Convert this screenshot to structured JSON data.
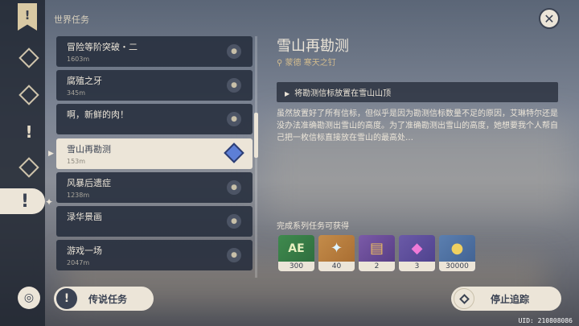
{
  "list_title": "世界任务",
  "quests": [
    {
      "name": "冒险等阶突破・二",
      "dist": "1603m",
      "selected": false
    },
    {
      "name": "腐殖之牙",
      "dist": "345m",
      "selected": false
    },
    {
      "name": "啊，新鲜的肉！",
      "dist": "",
      "selected": false
    },
    {
      "name": "雪山再勘测",
      "dist": "153m",
      "selected": true
    },
    {
      "name": "风暴后遗症",
      "dist": "1238m",
      "selected": false
    },
    {
      "name": "渌华景画",
      "dist": "",
      "selected": false
    },
    {
      "name": "游戏一场",
      "dist": "2047m",
      "selected": false
    }
  ],
  "legend_button": "传说任务",
  "detail": {
    "title": "雪山再勘测",
    "location": "蒙德 寒天之钉",
    "objective": "将勘测信标放置在雪山山顶",
    "description": "虽然放置好了所有信标，但似乎是因为勘测信标数量不足的原因，艾琳特尔还是没办法准确勘测出雪山的高度。为了准确勘测出雪山的高度，她想要我个人帮自己把一枚信标直接放在雪山的最高处…"
  },
  "reward_label": "完成系列任务可获得",
  "rewards": [
    {
      "icon": "adventure-exp-icon",
      "count": "300"
    },
    {
      "icon": "primogem-icon",
      "count": "40"
    },
    {
      "icon": "heros-wit-icon",
      "count": "2"
    },
    {
      "icon": "mystic-ore-icon",
      "count": "3"
    },
    {
      "icon": "mora-icon",
      "count": "30000"
    }
  ],
  "stop_button": "停止追踪",
  "uid": "UID: 210808086"
}
